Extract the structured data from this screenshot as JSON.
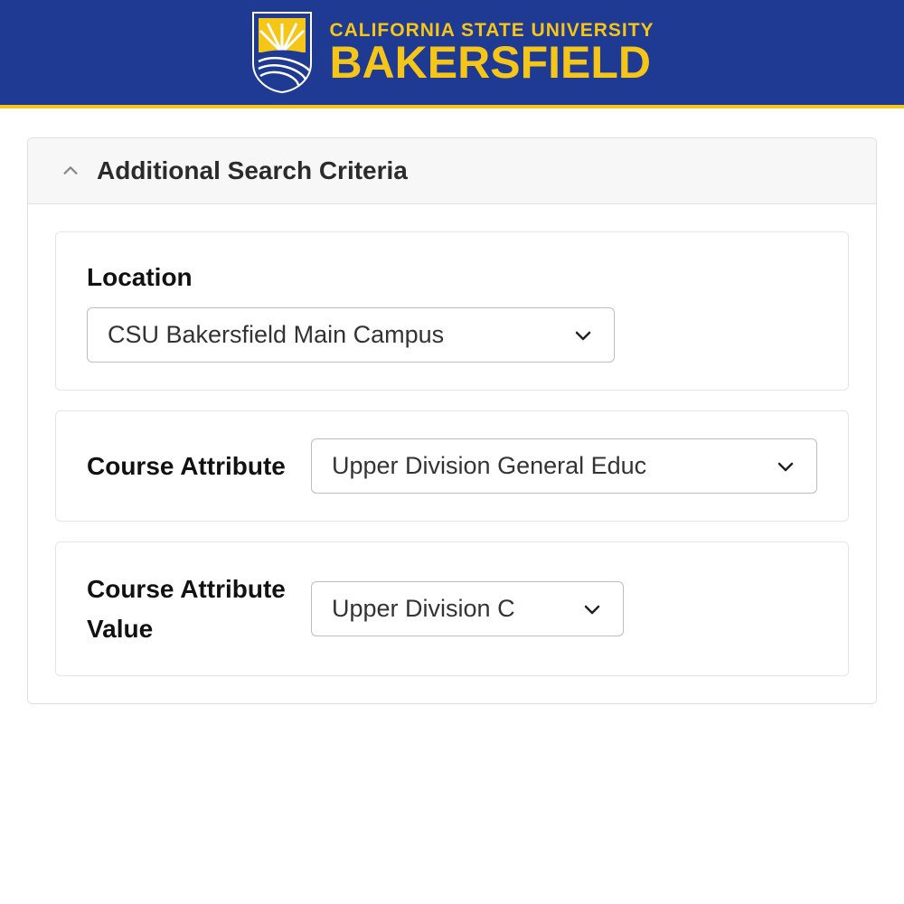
{
  "header": {
    "university_line": "CALIFORNIA STATE UNIVERSITY",
    "university_name": "BAKERSFIELD"
  },
  "panel": {
    "title": "Additional Search Criteria"
  },
  "fields": {
    "location": {
      "label": "Location",
      "value": "CSU Bakersfield Main Campus"
    },
    "course_attribute": {
      "label": "Course Attribute",
      "value": "Upper Division General Educ"
    },
    "course_attribute_value": {
      "label": "Course Attribute Value",
      "value": "Upper Division C"
    }
  }
}
